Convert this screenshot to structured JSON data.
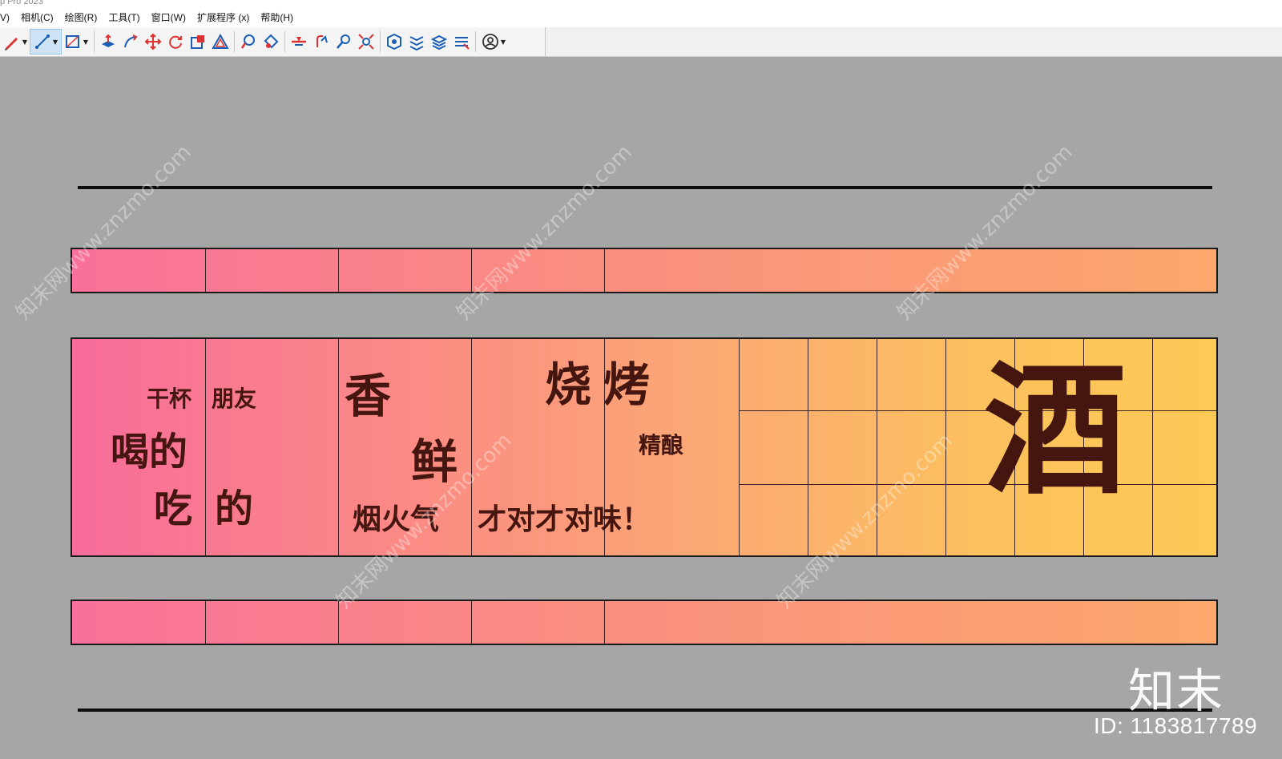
{
  "window": {
    "title": "p Pro 2023"
  },
  "menu": {
    "items": [
      "V)",
      "相机(C)",
      "绘图(R)",
      "工具(T)",
      "窗口(W)",
      "扩展程序 (x)",
      "帮助(H)"
    ]
  },
  "toolbar": {
    "tools": [
      "pencil-icon",
      "line-icon",
      "rectangle-icon",
      "push-pull-icon",
      "follow-me-icon",
      "move-icon",
      "rotate-icon",
      "scale-icon",
      "offset-icon",
      "tape-measure-icon",
      "paint-bucket-icon",
      "section-plane-icon",
      "orbit-icon",
      "zoom-icon",
      "zoom-extents-icon",
      "sandbox-icon",
      "layers-icon",
      "styles-icon",
      "components-icon",
      "user-icon"
    ],
    "active_tool": "line-icon"
  },
  "sign": {
    "texts": {
      "ganbei": "干杯",
      "pengyou": "朋友",
      "hede": "喝的",
      "chide_a": "吃",
      "chide_b": "的",
      "xiang": "香",
      "xian": "鲜",
      "yanhuoqi": "烟火气",
      "shao": "烧",
      "kao": "烤",
      "jingniang": "精酿",
      "duiwei": "才对才对味！",
      "jiu": "酒"
    },
    "colors": {
      "text": "#45150f",
      "gradient_start": "#f86c9b",
      "gradient_end": "#fdca55"
    }
  },
  "watermark": {
    "text": "知末网www.znzmo.com",
    "brand": "知末",
    "id_label": "ID: 1183817789"
  }
}
